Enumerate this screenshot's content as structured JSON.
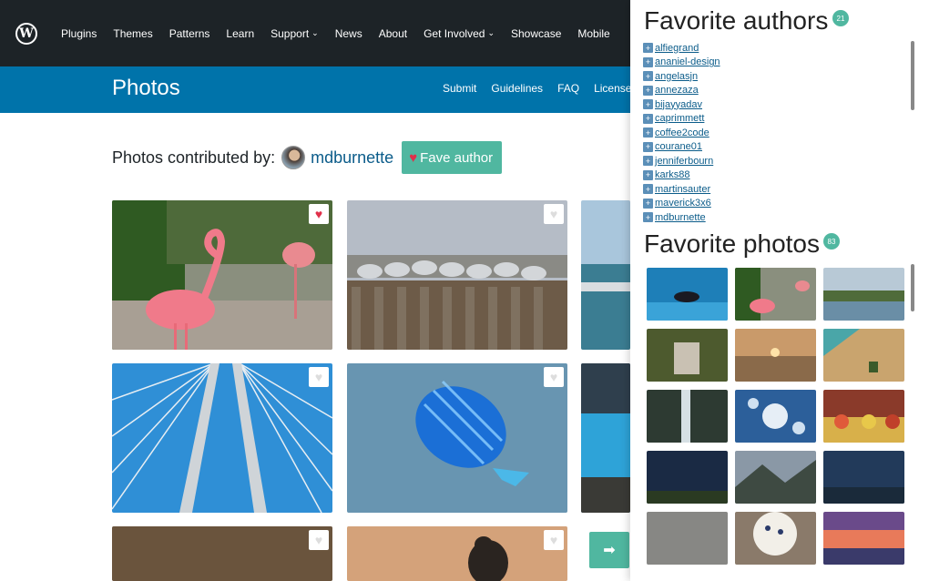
{
  "topnav": {
    "logo": "W",
    "links": [
      "Plugins",
      "Themes",
      "Patterns",
      "Learn",
      "Support",
      "News",
      "About",
      "Get Involved",
      "Showcase",
      "Mobile"
    ],
    "dropdown_indices": [
      4,
      7
    ],
    "chevron": "⌄"
  },
  "subheader": {
    "title": "Photos",
    "links": [
      "Submit",
      "Guidelines",
      "FAQ",
      "License"
    ]
  },
  "contributor": {
    "label": "Photos contributed by:",
    "username": "mdburnette",
    "fave_button_label": "Fave author",
    "fave_icon": "heart-icon"
  },
  "photos": [
    {
      "subject": "flamingo",
      "favorited": true
    },
    {
      "subject": "seagulls on pier",
      "favorited": false
    },
    {
      "subject": "waterfront",
      "favorited": false
    },
    {
      "subject": "bridge cables",
      "favorited": false
    },
    {
      "subject": "blue fish",
      "favorited": false
    },
    {
      "subject": "aquarium",
      "favorited": false
    },
    {
      "subject": "dry grass",
      "favorited": false
    },
    {
      "subject": "bird silhouette at sunset",
      "favorited": false
    }
  ],
  "heart_glyph": "♥",
  "next_button_icon": "arrow-right-icon",
  "next_glyph": "➡",
  "panel": {
    "authors_title": "Favorite authors",
    "authors_count": "21",
    "authors": [
      "alfiegrand",
      "ananiel-design",
      "angelasjn",
      "annezaza",
      "bijayyadav",
      "caprimmett",
      "coffee2code",
      "courane01",
      "jenniferbourn",
      "karks88",
      "martinsauter",
      "maverick3x6",
      "mdburnette"
    ],
    "photos_title": "Favorite photos",
    "photos_count": "83",
    "plus_glyph": "+"
  },
  "colors": {
    "topnav_bg": "#1d2327",
    "subheader_bg": "#0073aa",
    "accent_teal": "#50b7a0",
    "heart_red": "#e0304a",
    "link_blue": "#0b5c8a"
  }
}
